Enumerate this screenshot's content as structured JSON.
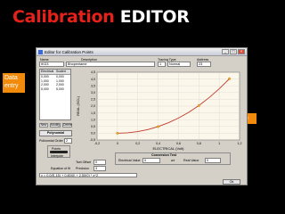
{
  "slide": {
    "title_word1": "Calibration",
    "title_word2": "EDITOR"
  },
  "callouts": {
    "data_entry": "Data entry",
    "interpolation": "Interpolation"
  },
  "window": {
    "title": "Editor for Calibration Points",
    "buttons": {
      "minimize": "_",
      "maximize": "□",
      "close": "×"
    }
  },
  "header": {
    "name_label": "Name",
    "name_value": "IKD3",
    "description_label": "Description",
    "description_value": "Bhopentame",
    "tracing_type_label": "Tracing Type",
    "tracing_type_value": "1",
    "tracing_mode_value": "Normal",
    "address_label": "Address",
    "address_value": "23"
  },
  "table": {
    "columns": [
      "Electrical",
      "Scaled"
    ],
    "rows": [
      [
        "0,000",
        "0,000"
      ],
      [
        "1,000",
        "1,000"
      ],
      [
        "2,000",
        "2,000"
      ],
      [
        "5,000",
        "5,000"
      ]
    ]
  },
  "list_buttons": {
    "new": "New",
    "modify": "Modify",
    "delete": "Delete"
  },
  "fit": {
    "polynomial_button": "Polynomial",
    "order_label": "Polinomial Order",
    "order_value": "2",
    "toggle_on": "Points",
    "toggle_off": "Interpole"
  },
  "plot": {
    "ylabel": "REAL (SCL)",
    "xlabel": "ELECTRICAL (Volt)",
    "y_ticks": [
      "4,5",
      "4,0",
      "3,5",
      "3,0",
      "2,5",
      "2,0",
      "1,5",
      "1,0",
      "0,5",
      "0,0",
      "-0,5"
    ],
    "x_ticks": [
      "-0,2",
      "0",
      "0,2",
      "0,4",
      "0,6",
      "0,8",
      "1",
      "1,2"
    ]
  },
  "chart_data": {
    "type": "line",
    "title": "",
    "xlabel": "ELECTRICAL (Volt)",
    "ylabel": "REAL (SCL)",
    "xlim": [
      -0.2,
      1.2
    ],
    "ylim": [
      -0.5,
      4.5
    ],
    "grid": true,
    "series": [
      {
        "kind": "curve",
        "color": "#c0392b",
        "x": [
          0.0,
          0.1,
          0.2,
          0.3,
          0.4,
          0.5,
          0.6,
          0.7,
          0.8,
          0.9,
          1.0,
          1.1
        ],
        "y": [
          0.0,
          0.03,
          0.12,
          0.27,
          0.49,
          0.77,
          1.12,
          1.54,
          2.04,
          2.62,
          3.28,
          4.02
        ]
      },
      {
        "kind": "points",
        "color": "#f5a623",
        "x": [
          0.0,
          0.4,
          0.8,
          1.1
        ],
        "y": [
          0.0,
          0.49,
          2.04,
          4.02
        ]
      }
    ]
  },
  "conversion": {
    "title": "Conversion Test",
    "electrical_label": "Electrical Value",
    "electrical_value": "0",
    "arrow": "=>",
    "scaled_label": "Real Value",
    "scaled_value": "0"
  },
  "tset": {
    "tset_label": "Tset Offset",
    "tset_value": "0",
    "eq_label": "Equation of fit",
    "precision_label": "Precision",
    "precision_value": "3"
  },
  "equation": "y = 0,0(E-15) + 0,80(0) + 2,50(0) * x^2",
  "ok_button": "Ok"
}
